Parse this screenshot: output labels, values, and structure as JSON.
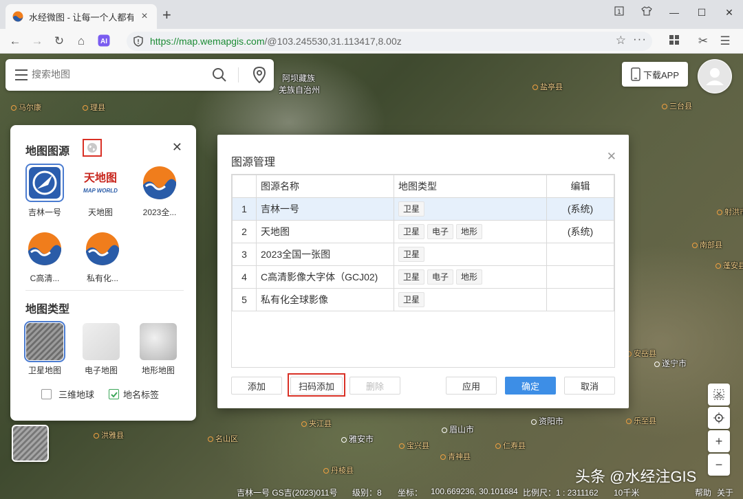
{
  "browser": {
    "tab_title": "水经微图 - 让每一个人都有自",
    "new_tab": "+",
    "url_scheme_host": "https://map.wemapgis.com",
    "url_path": "/@103.245530,31.113417,8.00z"
  },
  "search": {
    "placeholder": "搜索地图"
  },
  "download_app": "下载APP",
  "map_labels": {
    "aba_line1": "阿坝藏族",
    "aba_line2": "羌族自治州",
    "ya_an": "雅安市",
    "meishan": "眉山市",
    "ziyang": "资阳市",
    "suining": "遂宁市",
    "l1": "马尔康",
    "l2": "理县",
    "l3": "盐亭县",
    "l4": "三台县",
    "l5": "射洪市",
    "l6": "南部县",
    "l7": "蓬安县",
    "l8": "安岳县",
    "l9": "夹江县",
    "l10": "洪雅县",
    "l11": "名山区",
    "l12": "宝兴县",
    "l13": "丹棱县",
    "l14": "青神县",
    "l15": "乐至县",
    "l16": "仁寿县"
  },
  "left_panel": {
    "source_title": "地图图源",
    "sources": [
      "吉林一号",
      "天地图",
      "2023全...",
      "C高清...",
      "私有化..."
    ],
    "type_title": "地图类型",
    "types": [
      "卫星地图",
      "电子地图",
      "地形地图"
    ],
    "checkbox_3d": "三维地球",
    "checkbox_labels": "地名标签"
  },
  "dialog": {
    "title": "图源管理",
    "headers": [
      "",
      "图源名称",
      "地图类型",
      "编辑"
    ],
    "rows": [
      {
        "no": "1",
        "name": "吉林一号",
        "types": [
          "卫星"
        ],
        "edit": "(系统)"
      },
      {
        "no": "2",
        "name": "天地图",
        "types": [
          "卫星",
          "电子",
          "地形"
        ],
        "edit": "(系统)"
      },
      {
        "no": "3",
        "name": "2023全国一张图",
        "types": [
          "卫星"
        ],
        "edit": ""
      },
      {
        "no": "4",
        "name": "C高清影像大字体（GCJ02)",
        "types": [
          "卫星",
          "电子",
          "地形"
        ],
        "edit": ""
      },
      {
        "no": "5",
        "name": "私有化全球影像",
        "types": [
          "卫星"
        ],
        "edit": ""
      }
    ],
    "buttons": {
      "add": "添加",
      "scan_add": "扫码添加",
      "delete": "删除",
      "apply": "应用",
      "ok": "确定",
      "cancel": "取消"
    }
  },
  "map_controls": {
    "zoom_in": "+",
    "zoom_out": "−"
  },
  "status": {
    "source": "吉林一号 GS吉(2023)011号",
    "level": "级别：8",
    "coord": "坐标：",
    "coord_value": "100.669236, 30.101684",
    "scale": "比例尺：1 : 2311162",
    "distance": "10千米",
    "help": "帮助",
    "about": "关于"
  },
  "watermark": "头条 @水经注GIS",
  "colors": {
    "accent": "#3d8ee6",
    "highlight": "#d93025",
    "url_green": "#1b8b34",
    "selected_row": "#e6f0fb"
  }
}
